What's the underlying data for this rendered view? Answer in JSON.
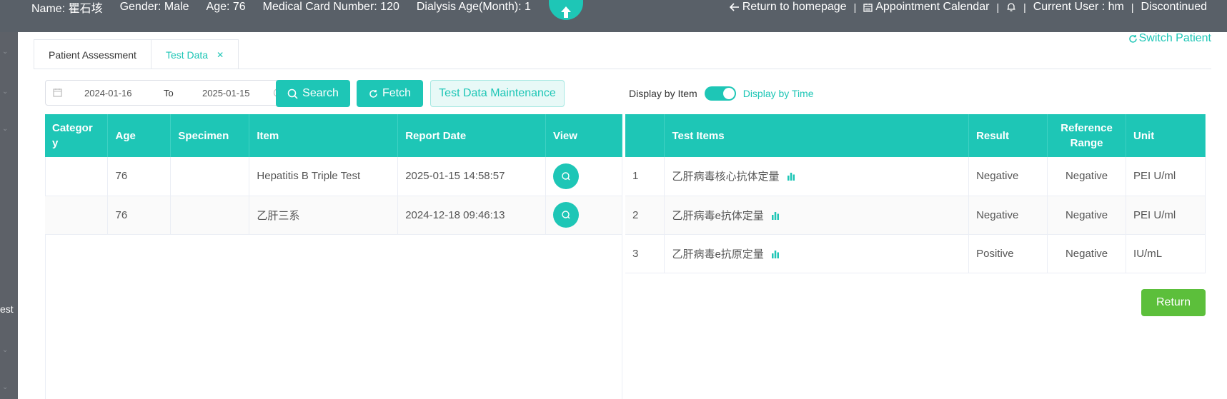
{
  "header": {
    "patient": {
      "name": "Name: 瞿石垓",
      "gender": "Gender: Male",
      "age": "Age: 76",
      "card": "Medical Card Number: 120",
      "dialysis": "Dialysis Age(Month): 1"
    },
    "nav": {
      "home": "Return to homepage",
      "calendar": "Appointment Calendar",
      "user": "Current User : hm",
      "discontinued": "Discontinued"
    }
  },
  "sidebar": {
    "stub_text": "est"
  },
  "tabs": [
    {
      "label": "Patient Assessment"
    },
    {
      "label": "Test Data"
    }
  ],
  "switch_patient": "Switch Patient",
  "toolbar": {
    "start_date": "2024-01-16",
    "to_label": "To",
    "end_date": "2025-01-15",
    "search": "Search",
    "fetch": "Fetch",
    "maintenance": "Test Data Maintenance",
    "display_item": "Display by Item",
    "display_time": "Display by Time"
  },
  "left_table": {
    "headers": [
      "Categor y",
      "Age",
      "Specimen",
      "Item",
      "Report Date",
      "View"
    ],
    "rows": [
      {
        "category": "",
        "age": "76",
        "specimen": "",
        "item": "Hepatitis B Triple Test",
        "date": "2025-01-15 14:58:57"
      },
      {
        "category": "",
        "age": "76",
        "specimen": "",
        "item": "乙肝三系",
        "date": "2024-12-18 09:46:13"
      }
    ]
  },
  "right_table": {
    "headers": [
      "",
      "Test Items",
      "Result",
      "Reference Range",
      "Unit"
    ],
    "rows": [
      {
        "no": "1",
        "item": "乙肝病毒核心抗体定量",
        "result": "Negative",
        "range": "Negative",
        "unit": "PEI U/ml"
      },
      {
        "no": "2",
        "item": "乙肝病毒e抗体定量",
        "result": "Negative",
        "range": "Negative",
        "unit": "PEI U/ml"
      },
      {
        "no": "3",
        "item": "乙肝病毒e抗原定量",
        "result": "Positive",
        "range": "Negative",
        "unit": "IU/mL"
      }
    ]
  },
  "return_label": "Return",
  "colors": {
    "accent": "#1ec6b6",
    "header_bg": "#596068",
    "return_green": "#5cbf3b"
  }
}
